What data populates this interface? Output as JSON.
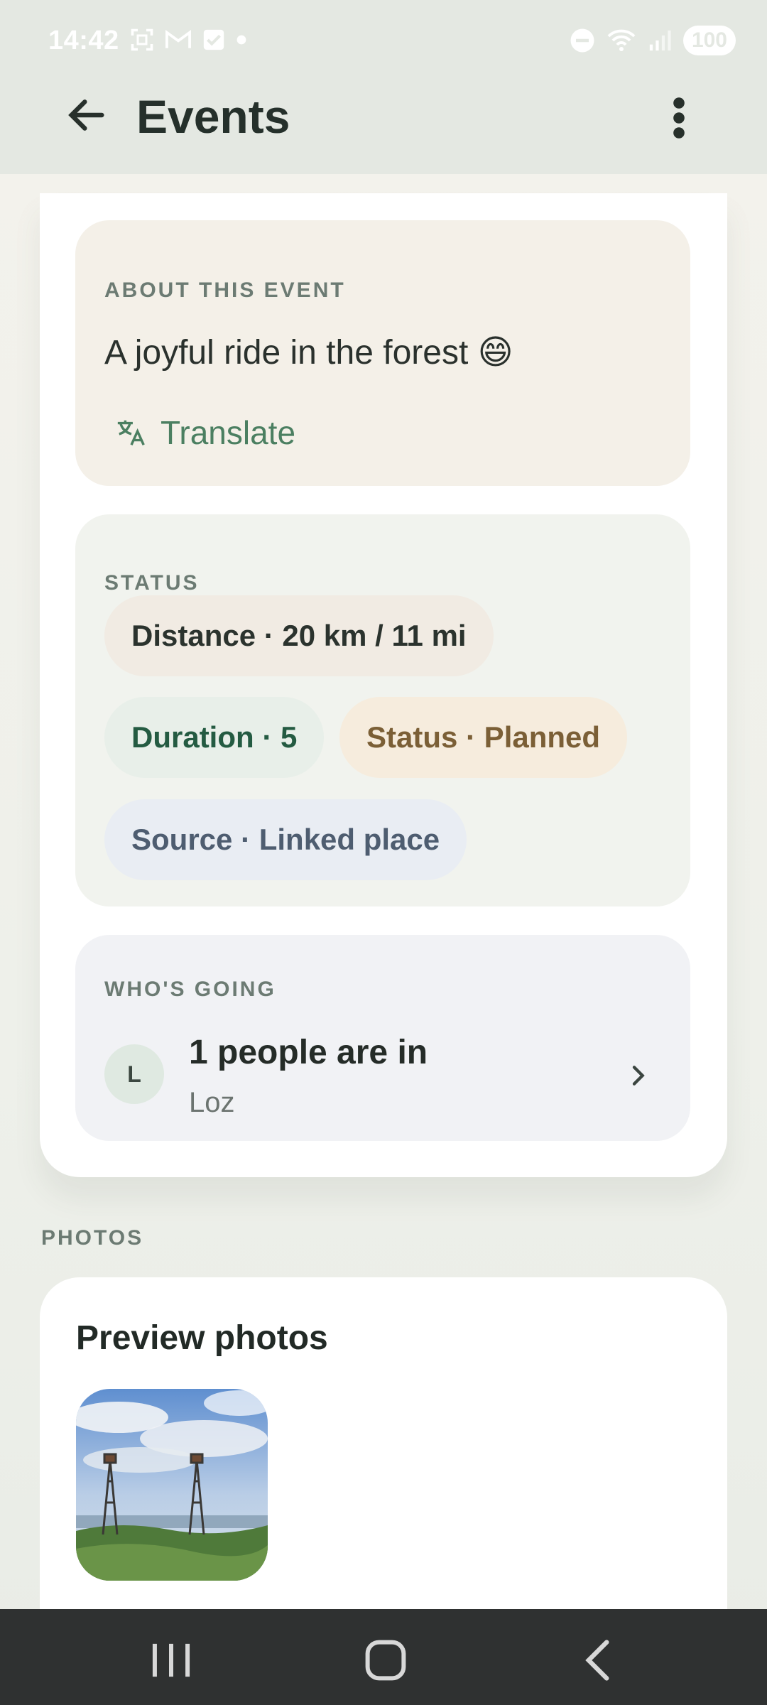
{
  "status_bar": {
    "time": "14:42",
    "battery": "100",
    "icons_left": [
      "screenshot-icon",
      "gmail-icon",
      "tasks-icon",
      "dot-icon"
    ],
    "icons_right": [
      "dnd-icon",
      "wifi-icon",
      "signal-icon",
      "battery-icon"
    ]
  },
  "app_bar": {
    "title": "Events",
    "back_icon": "arrow-left-icon",
    "menu_icon": "more-vert-icon"
  },
  "about": {
    "label": "ABOUT THIS EVENT",
    "text": "A joyful ride in the forest 😄",
    "translate_label": "Translate"
  },
  "status": {
    "label": "STATUS",
    "chips": {
      "distance": "Distance · 20 km / 11 mi",
      "duration": "Duration · 5",
      "status": "Status · Planned",
      "source": "Source · Linked place"
    }
  },
  "going": {
    "label": "WHO'S GOING",
    "avatar_initial": "L",
    "title": "1 people are in",
    "names": "Loz"
  },
  "photos": {
    "label": "PHOTOS",
    "card_title": "Preview photos"
  },
  "colors": {
    "accent_green": "#4b7f61",
    "app_bar_bg": "#e4e8e2",
    "nav_bar_bg": "#2f3131"
  }
}
